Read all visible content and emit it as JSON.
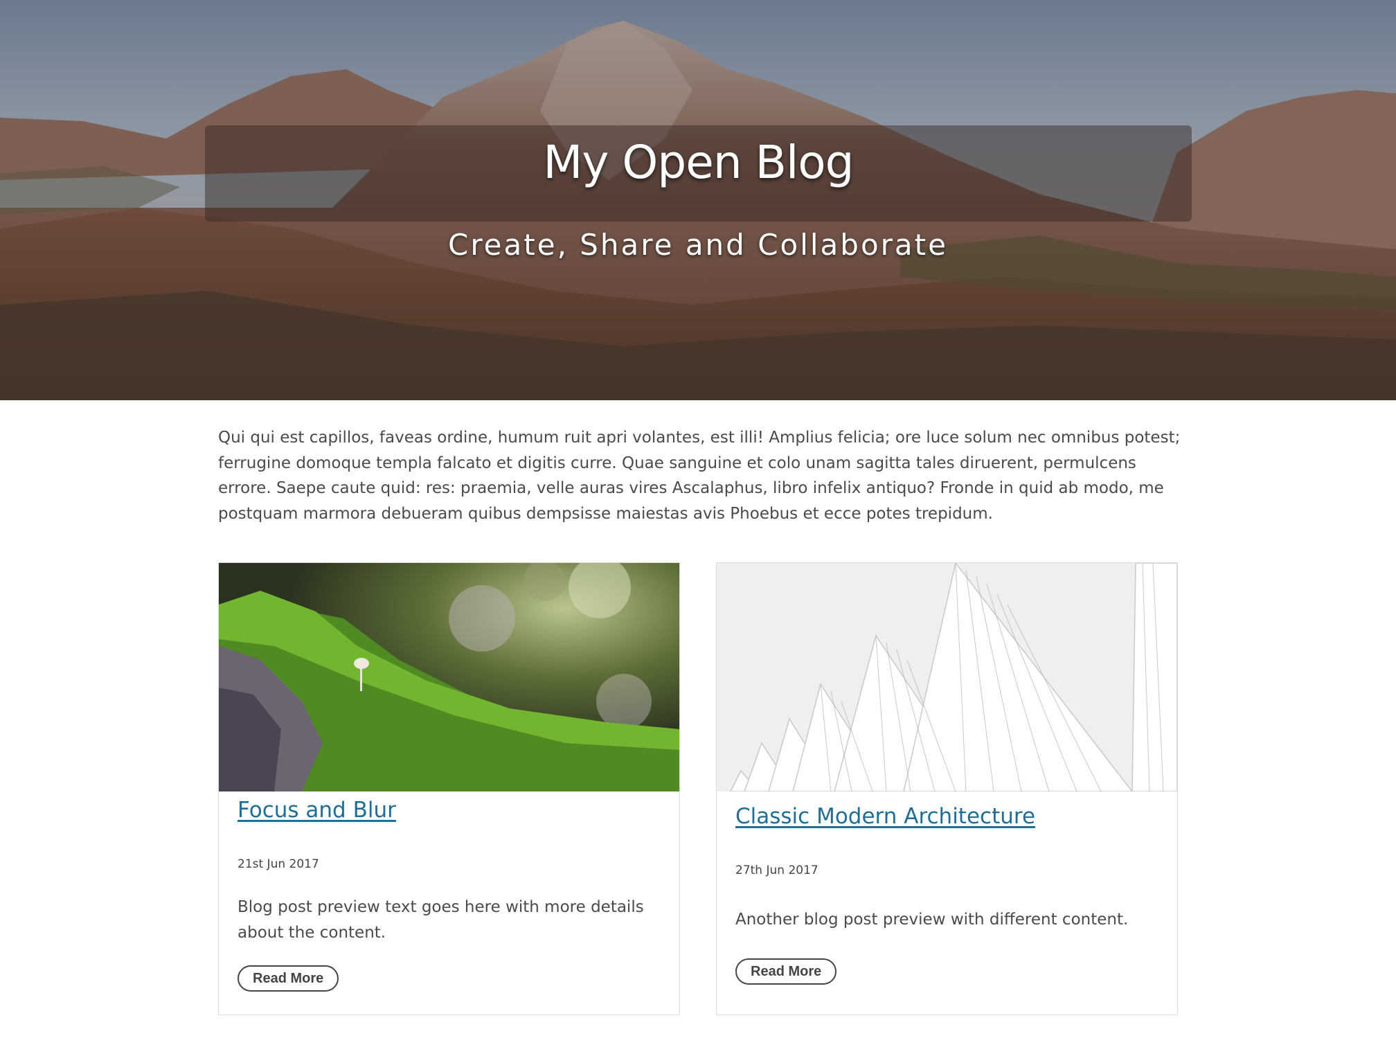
{
  "hero": {
    "title": "My Open Blog",
    "subtitle": "Create, Share and Collaborate"
  },
  "intro": {
    "text": "Qui qui est capillos, faveas ordine, humum ruit apri volantes, est illi! Amplius felicia; ore luce solum nec omnibus potest; ferrugine domoque templa falcato et digitis curre. Quae sanguine et colo unam sagitta tales diruerent, permulcens errore. Saepe caute quid: res: praemia, velle auras vires Ascalaphus, libro infelix antiquo? Fronde in quid ab modo, me postquam marmora debueram quibus dempsisse maiestas avis Phoebus et ecce potes trepidum."
  },
  "posts": [
    {
      "title": "Focus and Blur",
      "date": "21st Jun 2017",
      "preview": "Blog post preview text goes here with more details about the content.",
      "button": "Read More"
    },
    {
      "title": "Classic Modern Architecture",
      "date": "27th Jun 2017",
      "preview": "Another blog post preview with different content.",
      "button": "Read More"
    }
  ],
  "colors": {
    "link": "#1f6e97",
    "text": "#4a4a4a"
  }
}
